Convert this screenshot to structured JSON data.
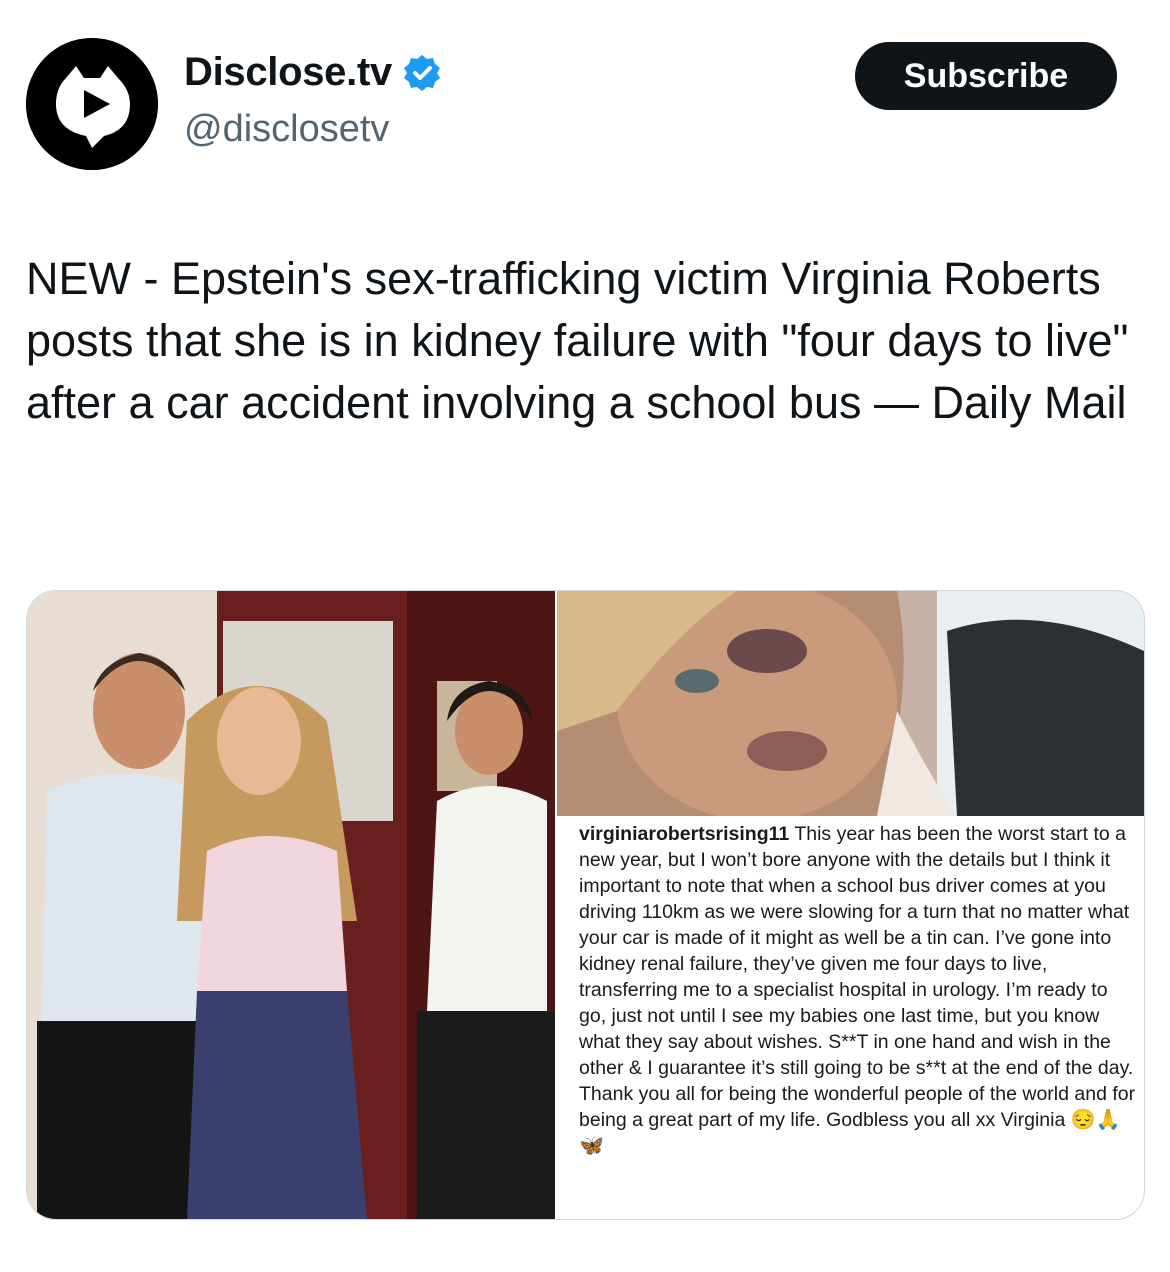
{
  "account": {
    "display_name": "Disclose.tv",
    "handle": "@disclosetv",
    "verified": true,
    "avatar_icon": "disclose-logo-icon",
    "verified_icon": "verified-badge-icon",
    "verified_color": "#1d9bf0"
  },
  "actions": {
    "subscribe_label": "Subscribe"
  },
  "tweet": {
    "text": "NEW - Epstein's sex-trafficking victim Virginia Roberts posts that she is in kidney failure with \"four days to live\" after a car accident involving a school bus — Daily Mail"
  },
  "media": {
    "caption_username": "virginiarobertsrising11",
    "caption_text": "This year has been the worst start to a new year, but I won’t bore anyone with the details but I think it important to note that when a school bus driver comes at you driving 110km as we were slowing for a turn that no matter what your car is made of it might as well be a tin can. I’ve gone into kidney renal failure, they’ve given me four days to live, transferring me to a specialist hospital in urology. I’m ready to go, just not until I see my babies one last time, but you know what they say about wishes. S**T in one hand and wish in the other & I guarantee it’s still going to be s**t at the end of the day. Thank you all for being the wonderful people of the world and for being a great part of my life. Godbless you all xx Virginia",
    "caption_emoji": "😔🙏🦋"
  }
}
